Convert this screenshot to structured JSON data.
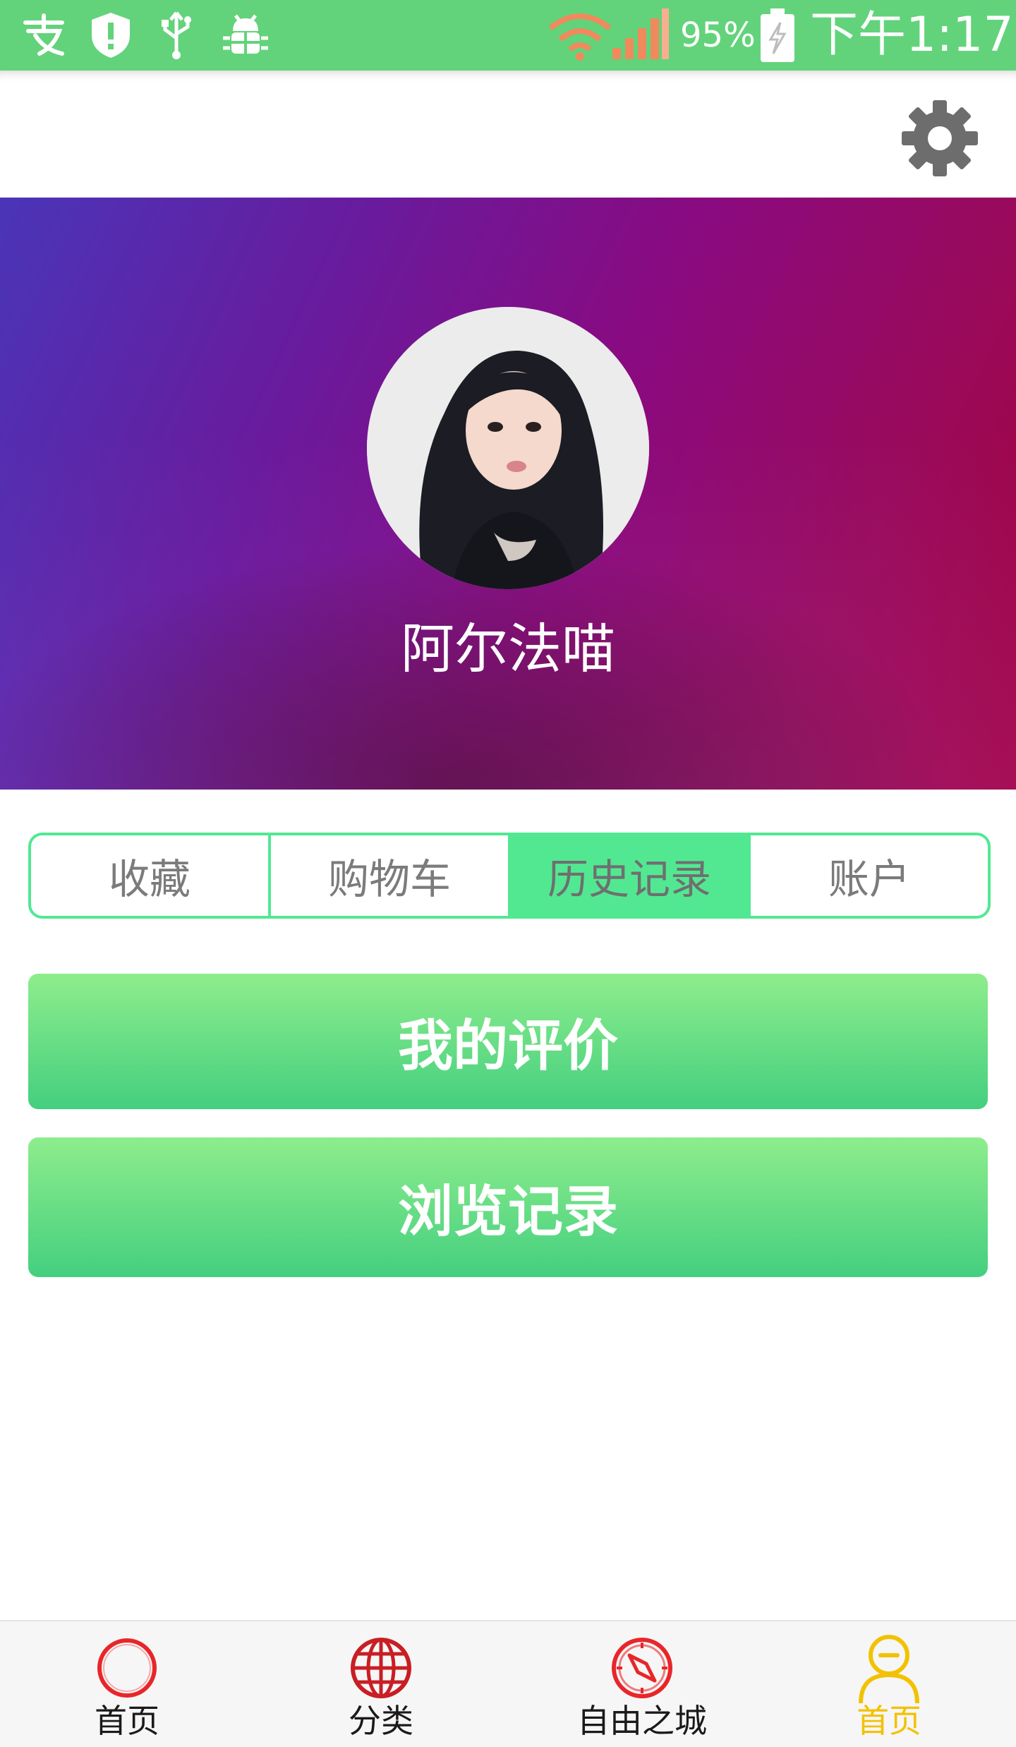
{
  "status_bar": {
    "battery_percent": "95%",
    "time": "下午1:17",
    "icons": [
      "alipay-icon",
      "shield-alert-icon",
      "usb-icon",
      "android-debug-icon",
      "wifi-icon",
      "signal-icon",
      "battery-charging-icon"
    ]
  },
  "action_bar": {
    "settings_icon": "gear-icon"
  },
  "profile": {
    "username": "阿尔法喵",
    "avatar": "user-avatar-photo"
  },
  "tabs": [
    {
      "label": "收藏",
      "active": false
    },
    {
      "label": "购物车",
      "active": false
    },
    {
      "label": "历史记录",
      "active": true
    },
    {
      "label": "账户",
      "active": false
    }
  ],
  "actions": {
    "my_reviews": "我的评价",
    "browse_history": "浏览记录"
  },
  "bottom_nav": [
    {
      "label": "首页",
      "icon": "home-circle-icon",
      "active": false
    },
    {
      "label": "分类",
      "icon": "globe-icon",
      "active": false
    },
    {
      "label": "自由之城",
      "icon": "compass-icon",
      "active": false
    },
    {
      "label": "首页",
      "icon": "user-profile-icon",
      "active": true
    }
  ],
  "colors": {
    "status_bar": "#62d37a",
    "accent_green": "#52e892",
    "nav_active": "#f2c200",
    "nav_red": "#e8262a"
  }
}
